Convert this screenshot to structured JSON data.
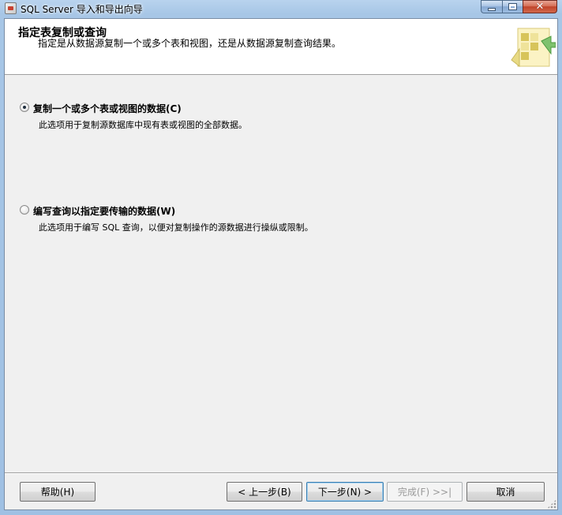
{
  "window": {
    "title": "SQL Server 导入和导出向导",
    "caption": {
      "minimize": "",
      "maximize": "",
      "close": "✕"
    }
  },
  "header": {
    "title": "指定表复制或查询",
    "description": "指定是从数据源复制一个或多个表和视图，还是从数据源复制查询结果。"
  },
  "options": [
    {
      "label": "复制一个或多个表或视图的数据(C)",
      "description": "此选项用于复制源数据库中现有表或视图的全部数据。",
      "checked": true
    },
    {
      "label": "编写查询以指定要传输的数据(W)",
      "description": "此选项用于编写 SQL 查询，以便对复制操作的源数据进行操纵或限制。",
      "checked": false
    }
  ],
  "buttons": {
    "help": "帮助(H)",
    "back": "< 上一步(B)",
    "next": "下一步(N) >",
    "finish": "完成(F) >>|",
    "cancel": "取消"
  },
  "colors": {
    "title_bar": "#a7c6e6",
    "close_button": "#c0432a",
    "client_background": "#f0f0f0",
    "header_background": "#ffffff"
  }
}
